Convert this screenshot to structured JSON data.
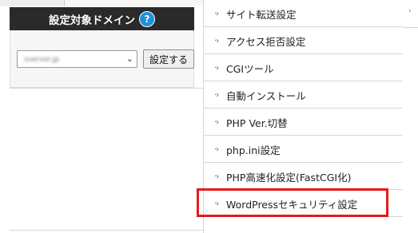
{
  "domain_panel": {
    "title": "設定対象ドメイン",
    "help_icon": "?",
    "selected_domain": "xserver.jp",
    "apply_button": "設定する",
    "chevron": "⌄"
  },
  "menu": {
    "items": [
      {
        "label": "サイト転送設定"
      },
      {
        "label": "アクセス拒否設定"
      },
      {
        "label": "CGIツール"
      },
      {
        "label": "自動インストール"
      },
      {
        "label": "PHP Ver.切替"
      },
      {
        "label": "php.ini設定"
      },
      {
        "label": "PHP高速化設定(FastCGI化)"
      },
      {
        "label": "WordPressセキュリティ設定"
      }
    ],
    "arrow_icon": "›"
  },
  "colors": {
    "header_bg": "#2a2a2a",
    "help_icon": "#1e90d8",
    "highlight": "#e8191a",
    "arrow": "#2b6cb0"
  }
}
